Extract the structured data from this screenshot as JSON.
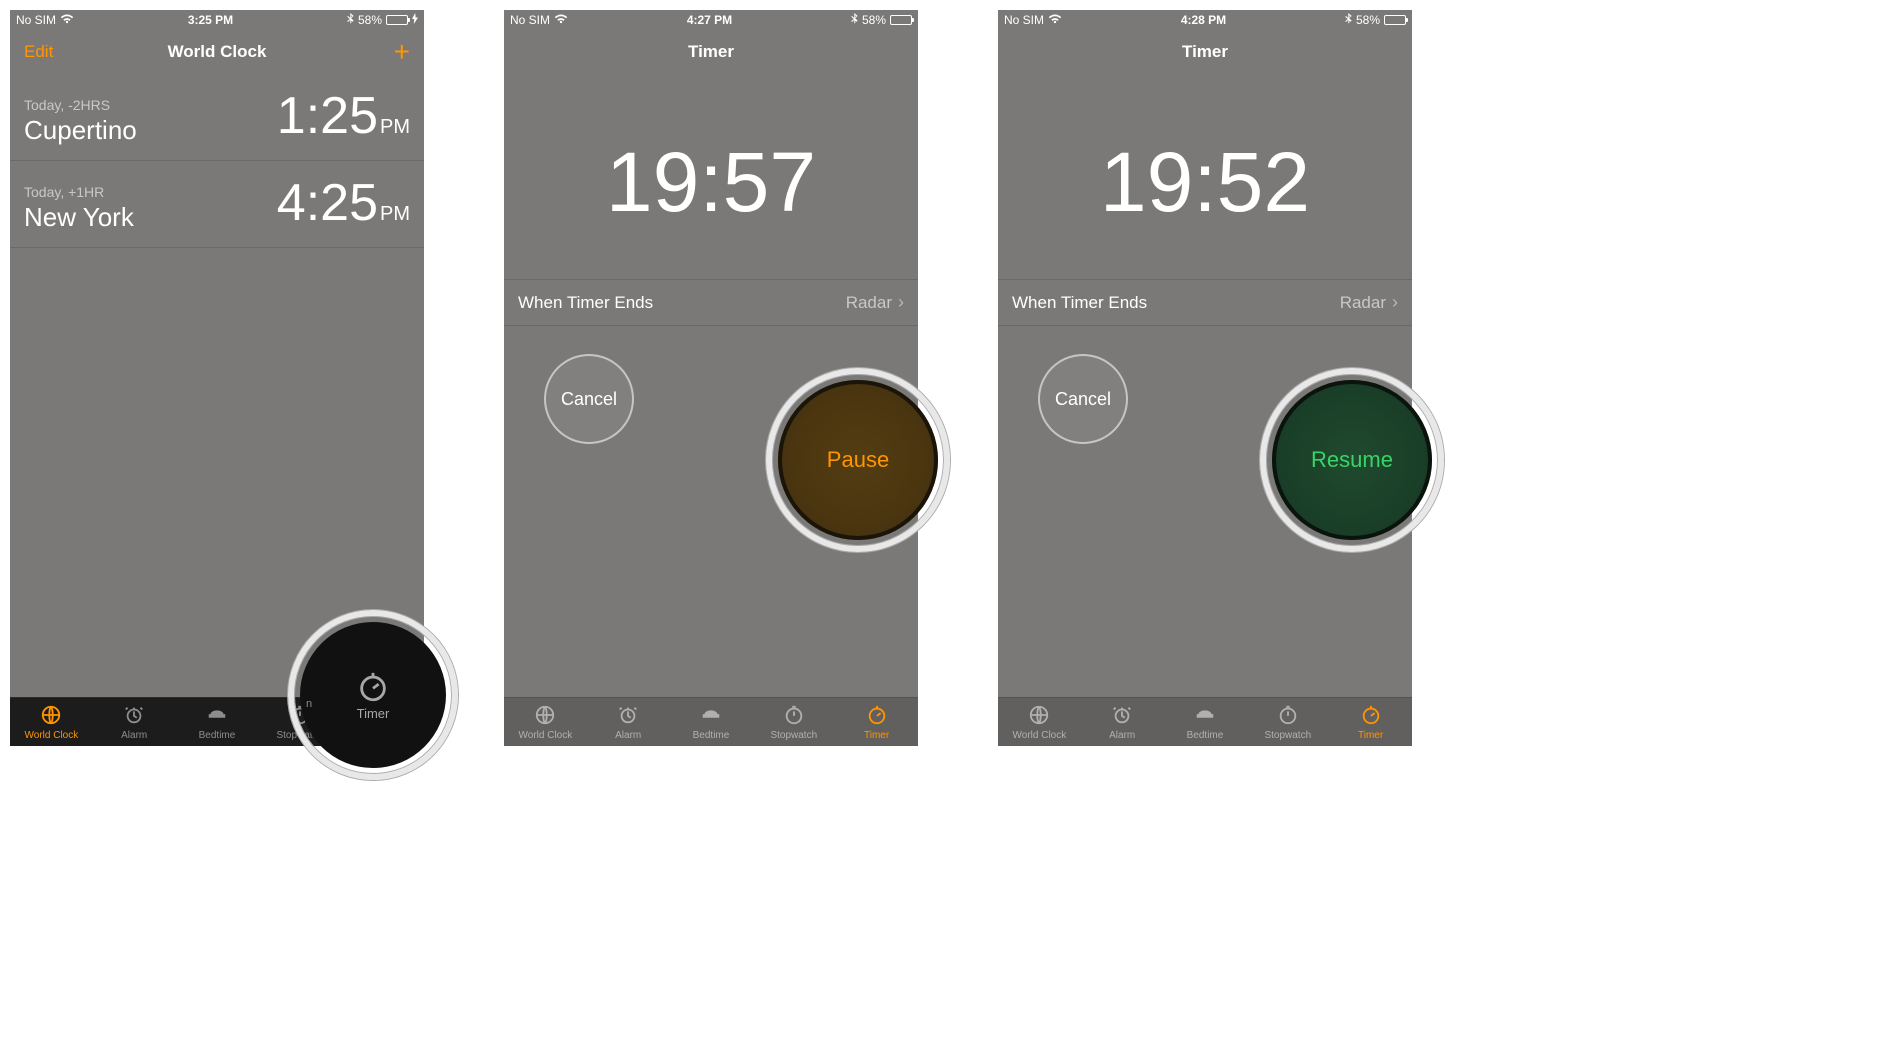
{
  "tabs": [
    "World Clock",
    "Alarm",
    "Bedtime",
    "Stopwatch",
    "Timer"
  ],
  "phone1": {
    "status": {
      "carrier": "No SIM",
      "time": "3:25 PM",
      "battery": "58%",
      "charging": true
    },
    "nav": {
      "edit": "Edit",
      "title": "World Clock",
      "add": "+"
    },
    "cities": [
      {
        "meta": "Today, -2HRS",
        "city": "Cupertino",
        "time": "1:25",
        "ampm": "PM"
      },
      {
        "meta": "Today, +1HR",
        "city": "New York",
        "time": "4:25",
        "ampm": "PM"
      }
    ],
    "activeTab": 0,
    "lens": {
      "label": "Timer",
      "stopFrag": "n"
    }
  },
  "phone2": {
    "status": {
      "carrier": "No SIM",
      "time": "4:27 PM",
      "battery": "58%",
      "charging": false
    },
    "nav": {
      "title": "Timer"
    },
    "timer": "19:57",
    "ends": {
      "label": "When Timer Ends",
      "value": "Radar"
    },
    "buttons": {
      "cancel": "Cancel",
      "action": "Pause"
    },
    "activeTab": 4
  },
  "phone3": {
    "status": {
      "carrier": "No SIM",
      "time": "4:28 PM",
      "battery": "58%",
      "charging": false
    },
    "nav": {
      "title": "Timer"
    },
    "timer": "19:52",
    "ends": {
      "label": "When Timer Ends",
      "value": "Radar"
    },
    "buttons": {
      "cancel": "Cancel",
      "action": "Resume"
    },
    "activeTab": 4
  }
}
